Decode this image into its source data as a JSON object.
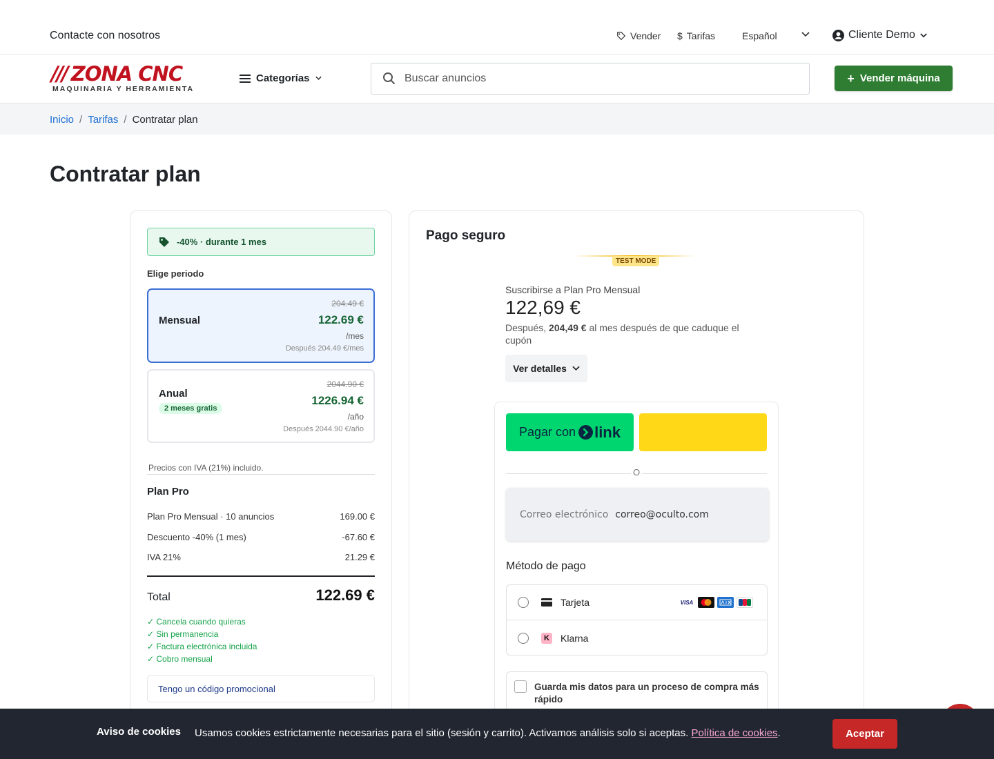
{
  "topbar": {
    "contact": "Contacte con nosotros",
    "sell": "Vender",
    "tariffs": "Tarifas",
    "language": "Español",
    "user": "Cliente Demo"
  },
  "nav": {
    "logo_main": "ZONA CNC",
    "logo_tagline": "MAQUINARIA Y HERRAMIENTA",
    "categories": "Categorías",
    "search_placeholder": "Buscar anuncios",
    "sell_button": "Vender máquina"
  },
  "breadcrumb": {
    "home": "Inicio",
    "tariffs": "Tarifas",
    "current": "Contratar plan"
  },
  "page_title": "Contratar plan",
  "plan_card": {
    "promo": "-40% · durante 1 mes",
    "period_label": "Elige periodo",
    "options": [
      {
        "name": "Mensual",
        "old_price": "204.49 €",
        "price": "122.69 €",
        "unit": "/mes",
        "after": "Después 204.49 €/mes",
        "selected": true
      },
      {
        "name": "Anual",
        "badge": "2 meses gratis",
        "old_price": "2044.90 €",
        "price": "1226.94 €",
        "unit": "/año",
        "after": "Después 2044.90 €/año",
        "selected": false
      }
    ],
    "vat_note": "Precios con IVA (21%) incluido.",
    "plan_title": "Plan Pro",
    "lines": [
      {
        "label": "Plan Pro Mensual · 10 anuncios",
        "value": "169.00 €"
      },
      {
        "label": "Descuento -40% (1 mes)",
        "value": "-67.60 €"
      },
      {
        "label": "IVA 21%",
        "value": "21.29 €"
      }
    ],
    "total_label": "Total",
    "total_value": "122.69 €",
    "benefits": [
      "✓ Cancela cuando quieras",
      "✓ Sin permanencia",
      "✓ Factura electrónica incluida",
      "✓ Cobro mensual"
    ],
    "promo_code": "Tengo un código promocional"
  },
  "payment": {
    "title": "Pago seguro",
    "test_mode": "TEST MODE",
    "subscribe_label": "Suscribirse a Plan Pro Mensual",
    "price": "122,69 €",
    "after_prefix": "Después,",
    "after_amount": "204,49 €",
    "after_suffix": "al mes después de que caduque el cupón",
    "details_button": "Ver detalles",
    "link_prefix": "Pagar con",
    "link_brand": "link",
    "or": "O",
    "email_label": "Correo electrónico",
    "email_value": "correo@oculto.com",
    "method_title": "Método de pago",
    "methods": [
      {
        "label": "Tarjeta",
        "icon": "credit-card-icon"
      },
      {
        "label": "Klarna",
        "icon": "klarna-icon"
      }
    ],
    "card_brands": [
      "VISA",
      "mastercard",
      "amex",
      "jcb"
    ],
    "save_label": "Guarda mis datos para un proceso de compra más rápido"
  },
  "cookie": {
    "title": "Aviso de cookies",
    "message": "Usamos cookies estrictamente necesarias para el sitio (sesión y carrito). Activamos análisis solo si aceptas.",
    "policy": "Política de cookies",
    "period": ".",
    "accept": "Aceptar"
  },
  "colors": {
    "brand_red": "#c1121f",
    "primary_green": "#2e7d32",
    "link_blue": "#1e6fd1",
    "link_green": "#00d66f",
    "cookie_bg": "#212631"
  }
}
